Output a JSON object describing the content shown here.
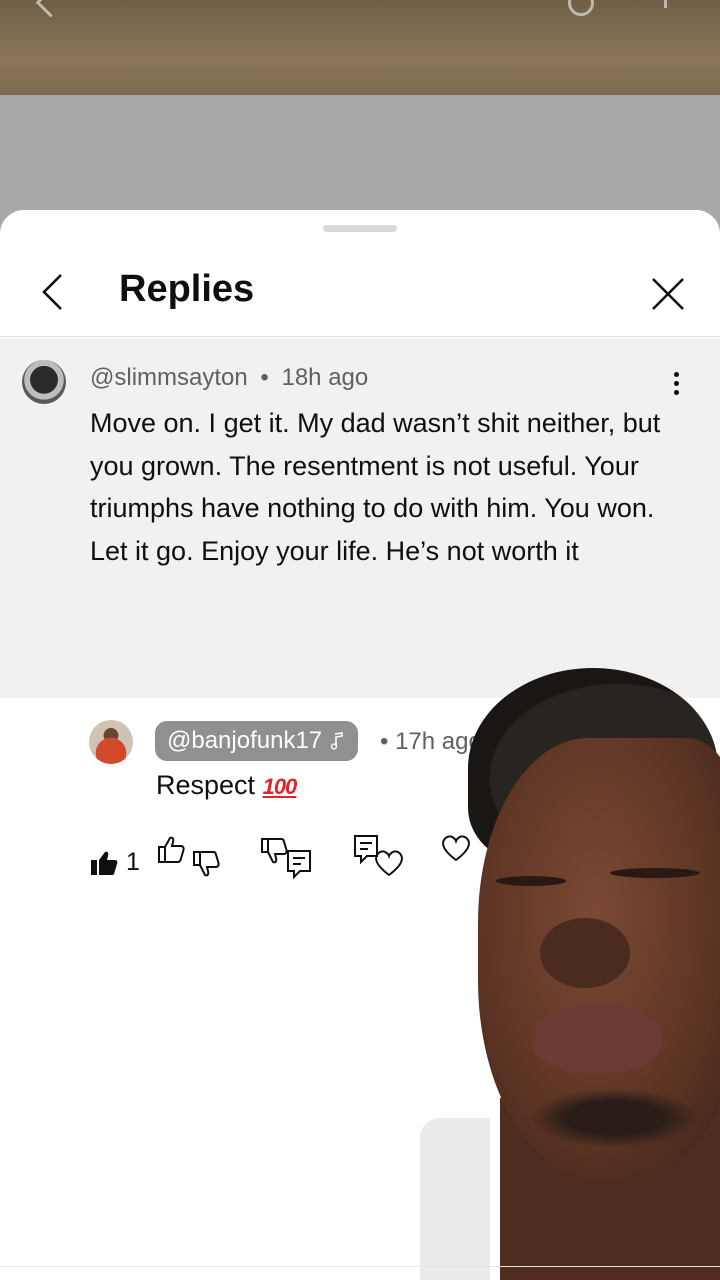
{
  "header": {
    "title": "Replies"
  },
  "parent_comment": {
    "handle": "@slimmsayton",
    "separator": "•",
    "time": "18h ago",
    "text": "Move on. I get it. My dad wasn’t shit neither, but you grown. The resentment is not useful. Your triumphs have nothing to do with him. You won. Let it go. Enjoy your life. He’s not worth it",
    "like_count": "1",
    "liked": true
  },
  "reply": {
    "handle": "@banjofunk17",
    "handle_badge_icon": "music-note-icon",
    "separator": "•",
    "time": "17h ago",
    "text": "Respect",
    "emoji": "100"
  },
  "colors": {
    "sheet_bg": "#ffffff",
    "parent_bg": "#f1f1f1",
    "handle_chip": "#909090",
    "text": "#0f0f0f",
    "muted": "#606060",
    "emoji_red": "#e0252a"
  }
}
